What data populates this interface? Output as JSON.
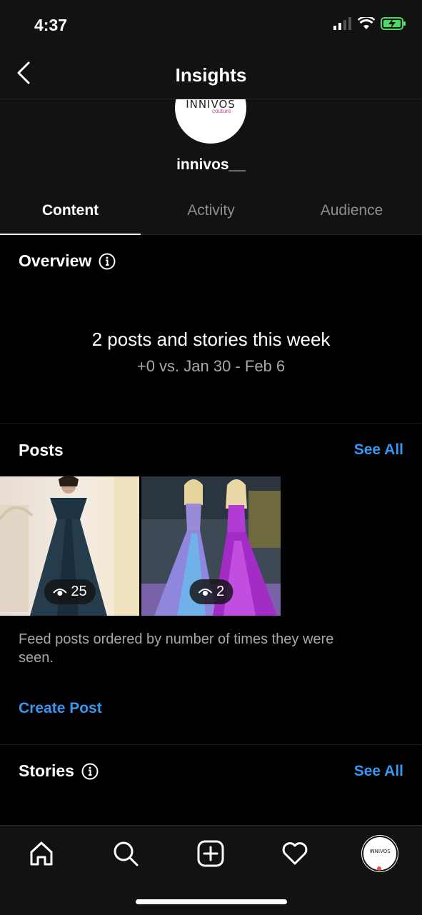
{
  "status": {
    "time": "4:37"
  },
  "nav": {
    "title": "Insights"
  },
  "profile": {
    "username": "innivos__",
    "logo_text": "INNIVOS",
    "logo_sub": "couture"
  },
  "tabs": [
    {
      "label": "Content",
      "active": true
    },
    {
      "label": "Activity",
      "active": false
    },
    {
      "label": "Audience",
      "active": false
    }
  ],
  "overview": {
    "title": "Overview",
    "main": "2 posts and stories this week",
    "sub": "+0 vs. Jan 30 - Feb 6"
  },
  "posts": {
    "title": "Posts",
    "see_all": "See All",
    "items": [
      {
        "views": "25"
      },
      {
        "views": "2"
      }
    ],
    "caption": "Feed posts ordered by number of times they were seen.",
    "create": "Create Post"
  },
  "stories": {
    "title": "Stories",
    "see_all": "See All"
  },
  "tabbar": {
    "avatar_text": "INNIVOS"
  },
  "colors": {
    "accent": "#3897f0",
    "bg": "#000000",
    "surface": "#121212"
  }
}
